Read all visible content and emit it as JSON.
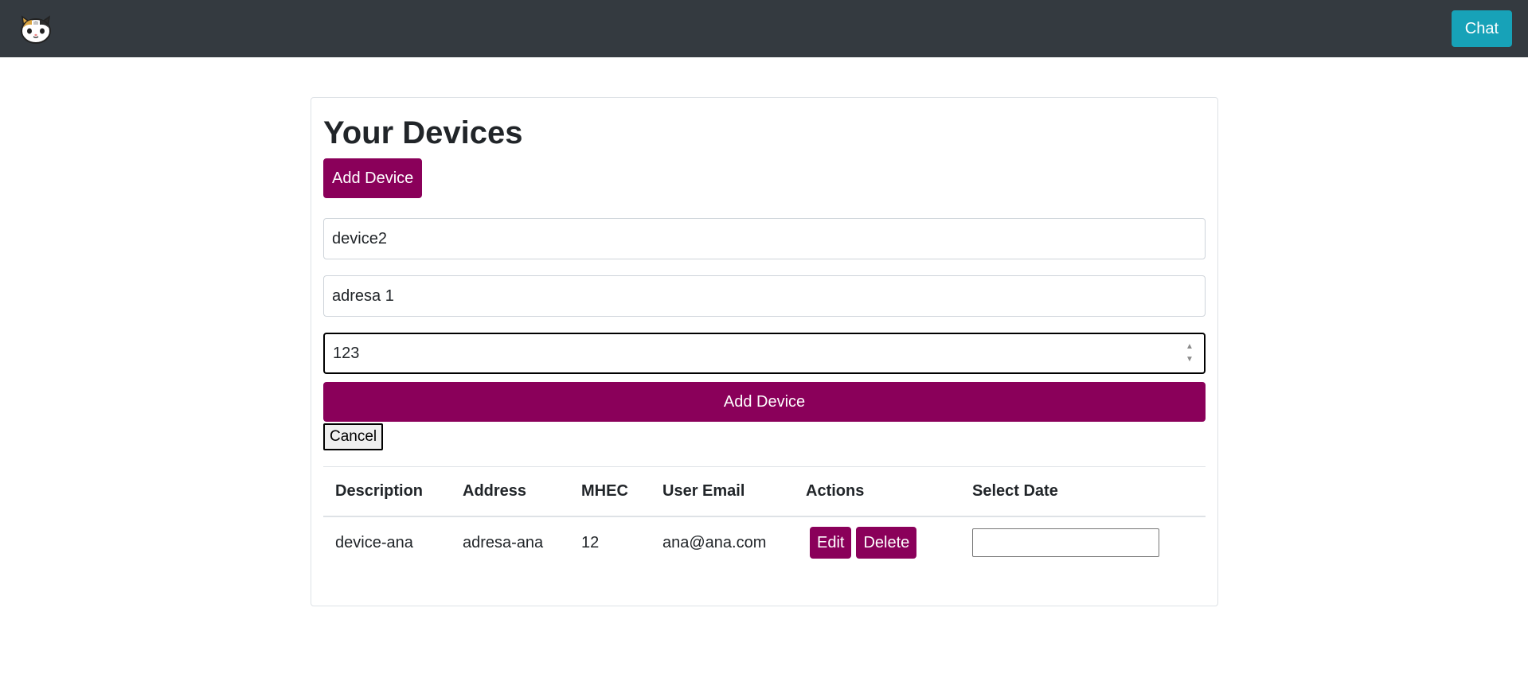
{
  "navbar": {
    "logo_icon": "cat-face-icon",
    "chat_label": "Chat"
  },
  "page": {
    "title": "Your Devices",
    "add_device_label": "Add Device"
  },
  "form": {
    "description_value": "device2",
    "address_value": "adresa 1",
    "mhec_value": "123",
    "submit_label": "Add Device",
    "cancel_label": "Cancel"
  },
  "table": {
    "headers": {
      "description": "Description",
      "address": "Address",
      "mhec": "MHEC",
      "user_email": "User Email",
      "actions": "Actions",
      "select_date": "Select Date"
    },
    "rows": [
      {
        "description": "device-ana",
        "address": "adresa-ana",
        "mhec": "12",
        "user_email": "ana@ana.com",
        "edit_label": "Edit",
        "delete_label": "Delete",
        "date_value": ""
      }
    ]
  },
  "colors": {
    "navbar_bg": "#343a40",
    "chat_button": "#17a2b8",
    "primary_purple": "#8a005a"
  }
}
